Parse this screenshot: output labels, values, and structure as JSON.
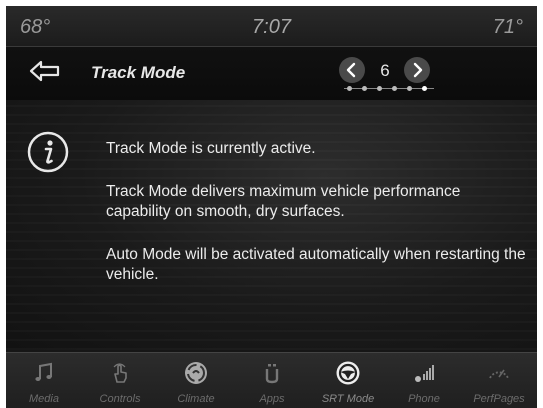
{
  "status": {
    "outside_temp": "68°",
    "time": "7:07",
    "inside_temp": "71°"
  },
  "header": {
    "title": "Track Mode",
    "page_number": "6",
    "page_count_dots": 6
  },
  "content": {
    "icon": "info-icon",
    "messages": [
      "Track Mode is currently active.",
      "Track Mode delivers maximum vehicle performance capability on smooth, dry surfaces.",
      "Auto Mode will be activated automatically when restarting the vehicle."
    ]
  },
  "nav": {
    "items": [
      {
        "label": "Media",
        "icon": "music-note-icon"
      },
      {
        "label": "Controls",
        "icon": "hand-touch-icon"
      },
      {
        "label": "Climate",
        "icon": "climate-fan-icon"
      },
      {
        "label": "Apps",
        "icon": "apps-icon"
      },
      {
        "label": "SRT Mode",
        "icon": "steering-wheel-icon"
      },
      {
        "label": "Phone",
        "icon": "bluetooth-signal-icon"
      },
      {
        "label": "PerfPages",
        "icon": "gauge-icon"
      }
    ],
    "active_index": 4
  }
}
